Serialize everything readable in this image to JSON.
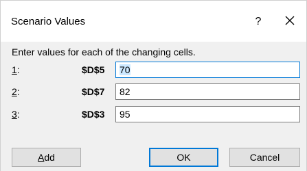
{
  "dialog": {
    "title": "Scenario Values",
    "help_label": "?",
    "instruction": "Enter values for each of the changing cells.",
    "rows": [
      {
        "num_mnemonic": "1",
        "num_rest": ":",
        "cell": "$D$5",
        "value": "70"
      },
      {
        "num_mnemonic": "2",
        "num_rest": ":",
        "cell": "$D$7",
        "value": "82"
      },
      {
        "num_mnemonic": "3",
        "num_rest": ":",
        "cell": "$D$3",
        "value": "95"
      }
    ],
    "buttons": {
      "add_mnemonic": "A",
      "add_rest": "dd",
      "ok": "OK",
      "cancel": "Cancel"
    }
  },
  "colors": {
    "content_bg": "#f0f0f0",
    "button_bg": "#e1e1e1",
    "default_button_border": "#0078d7",
    "selection_bg": "#cce8ff"
  },
  "icons": {
    "help": "question-mark-icon",
    "close": "close-icon"
  }
}
